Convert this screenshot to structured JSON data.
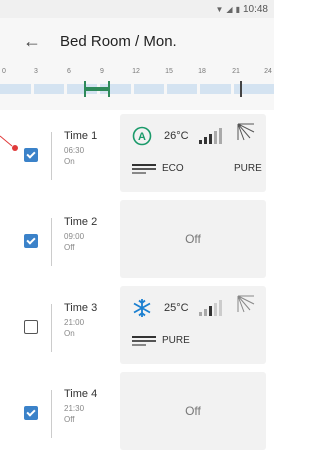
{
  "status_bar": {
    "time": "10:48"
  },
  "header": {
    "title": "Bed Room / Mon."
  },
  "timeline": {
    "hour_ticks": [
      "0",
      "3",
      "6",
      "9",
      "12",
      "15",
      "18",
      "21",
      "24"
    ],
    "colors": {
      "track": "#d4e3f1",
      "active": "#2e8a5a"
    }
  },
  "timers": [
    {
      "name": "Time 1",
      "time": "06:30",
      "state": "On",
      "checked": true,
      "card": {
        "off": false,
        "mode_icon": "auto-mode-icon",
        "temp": "26°C",
        "left_label": "ECO",
        "right_label": "PURE"
      }
    },
    {
      "name": "Time 2",
      "time": "09:00",
      "state": "Off",
      "checked": true,
      "card": {
        "off": true,
        "off_label": "Off"
      }
    },
    {
      "name": "Time 3",
      "time": "21:00",
      "state": "On",
      "checked": false,
      "card": {
        "off": false,
        "mode_icon": "cool-mode-icon",
        "temp": "25°C",
        "left_label": "PURE",
        "right_label": ""
      }
    },
    {
      "name": "Time 4",
      "time": "21:30",
      "state": "Off",
      "checked": true,
      "card": {
        "off": true,
        "off_label": "Off"
      }
    }
  ],
  "colors": {
    "checkbox": "#3b82c9",
    "card_bg": "#f2f2f2",
    "accent_mode": "#1a7fd0"
  }
}
